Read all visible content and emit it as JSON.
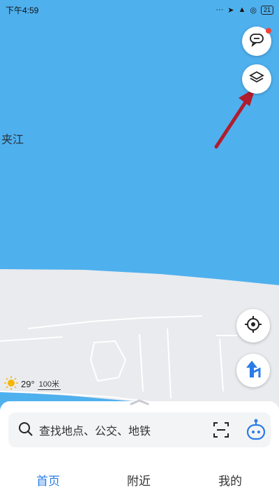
{
  "status_bar": {
    "time": "下午4:59",
    "battery": "21"
  },
  "map": {
    "place_label": "夹江"
  },
  "weather": {
    "temperature": "29°",
    "scale": "100米"
  },
  "search": {
    "placeholder": "查找地点、公交、地铁"
  },
  "tabs": [
    {
      "label": "首页",
      "active": true
    },
    {
      "label": "附近",
      "active": false
    },
    {
      "label": "我的",
      "active": false
    }
  ],
  "colors": {
    "water": "#4fb0ee",
    "land": "#e9ebee",
    "accent": "#2a7be8",
    "arrow": "#b01d2c"
  }
}
